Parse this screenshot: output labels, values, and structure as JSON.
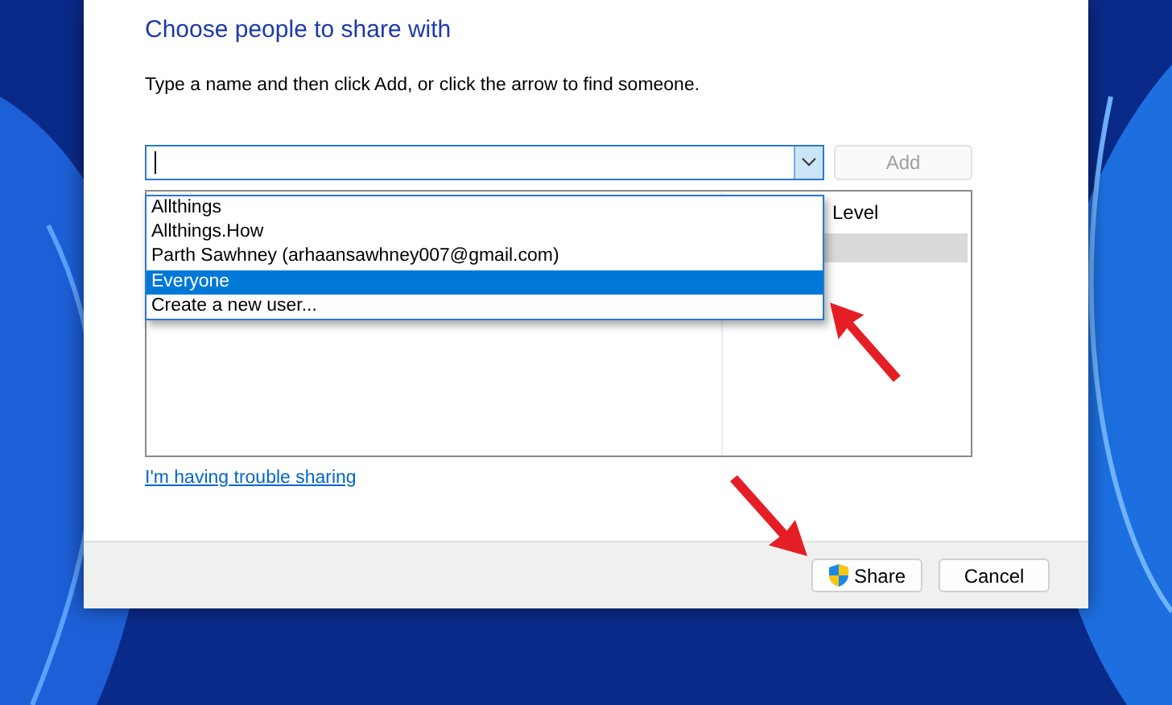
{
  "dialog": {
    "title": "Choose people to share with",
    "instruction": "Type a name and then click Add, or click the arrow to find someone."
  },
  "name_field": {
    "dropdown_open": true
  },
  "add_button": {
    "label": "Add",
    "disabled": true
  },
  "dropdown_options": [
    {
      "label": "Allthings",
      "selected": false
    },
    {
      "label": "Allthings.How",
      "selected": false
    },
    {
      "label": "Parth Sawhney (arhaansawhney007@gmail.com)",
      "selected": false
    },
    {
      "label": "Everyone",
      "selected": true
    },
    {
      "label": "Create a new user...",
      "selected": false
    }
  ],
  "table": {
    "column_2_header": "Level",
    "row_highlighted": true
  },
  "help_link": "I'm having trouble sharing",
  "footer_buttons": [
    {
      "kind": "share",
      "label": "Share"
    },
    {
      "kind": "plain",
      "label": "Cancel"
    }
  ]
}
